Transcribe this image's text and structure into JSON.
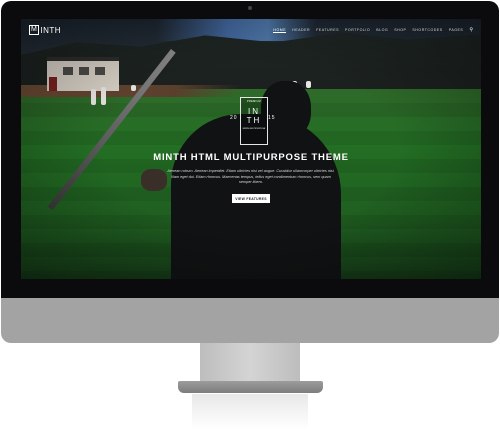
{
  "brand": {
    "logo_boxed": "M",
    "logo_rest": "INTH"
  },
  "nav": {
    "items": [
      {
        "label": "HOME",
        "active": true
      },
      {
        "label": "HEADER",
        "active": false
      },
      {
        "label": "FEATURES",
        "active": false
      },
      {
        "label": "PORTFOLIO",
        "active": false
      },
      {
        "label": "BLOG",
        "active": false
      },
      {
        "label": "SHOP",
        "active": false
      },
      {
        "label": "SHORTCODES",
        "active": false
      },
      {
        "label": "PAGES",
        "active": false
      }
    ],
    "search_icon": "search-icon"
  },
  "hero": {
    "emblem": {
      "top": "PREMIUM",
      "line1": "IN",
      "line2": "TH",
      "bottom": "MINTH MULTIPURPOSE"
    },
    "year_left": "20",
    "year_right": "15",
    "headline": "MINTH HTML MULTIPURPOSE THEME",
    "subtext": "Aenean rutrum. Aenean imperdiet. Etiam ultricies nisi vel augue. Curabitur ullamcorper ultricies nisi. Nam eget dui. Etiam rhoncus. Maecenas tempus, tellus eget condimentum rhoncus, sem quam semper libero.",
    "cta_label": "VIEW FEATURES"
  },
  "colors": {
    "bezel": "#0b0b0d",
    "chin": "#a3a3a3",
    "field": "#236f24",
    "cta_bg": "#ffffff"
  }
}
